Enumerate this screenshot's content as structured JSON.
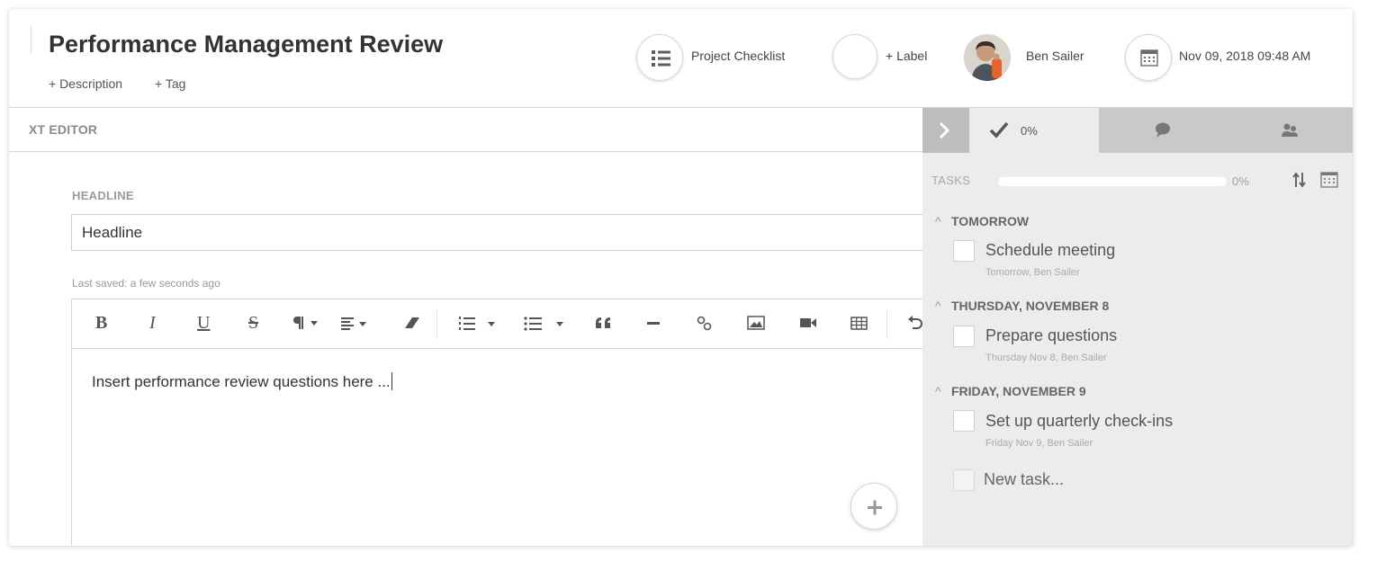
{
  "header": {
    "title": "Performance Management Review",
    "description_link": "+ Description",
    "tag_link": "+ Tag",
    "checklist_label": "Project Checklist",
    "label_link": "+ Label",
    "assignee_name": "Ben Sailer",
    "date": "Nov 09, 2018 09:48 AM",
    "checklist_icon": "list-icon",
    "date_icon": "calendar-icon"
  },
  "editor": {
    "tab_label": "XT EDITOR",
    "headline_label": "HEADLINE",
    "headline_value": "Headline",
    "last_saved": "Last saved: a few seconds ago",
    "body_text": "Insert performance review questions here ..."
  },
  "toolbar": {
    "bold": "B",
    "italic": "I",
    "underline": "U",
    "strike": "S"
  },
  "panel": {
    "tasks_tab_label": "0%",
    "tasks_label": "TASKS",
    "progress_fraction": 0,
    "progress_label": "0%",
    "accent_color": "#5b9bd5",
    "groups": [
      {
        "heading": "TOMORROW",
        "task": "Schedule meeting",
        "sub": "Tomorrow,  Ben Sailer"
      },
      {
        "heading": "THURSDAY, NOVEMBER 8",
        "task": "Prepare questions",
        "sub": "Thursday Nov 8,  Ben Sailer"
      },
      {
        "heading": "FRIDAY, NOVEMBER 9",
        "task": "Set up quarterly check-ins",
        "sub": "Friday Nov 9,  Ben Sailer"
      }
    ],
    "new_task_placeholder": "New task..."
  }
}
